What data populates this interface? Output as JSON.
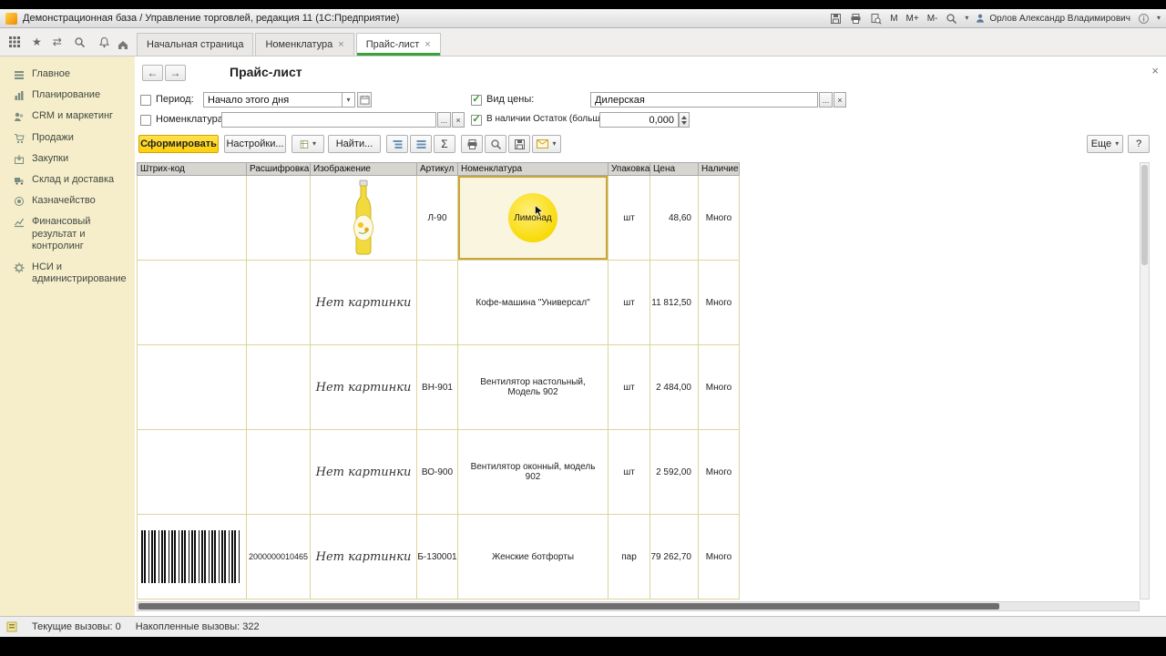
{
  "window": {
    "title": "Демонстрационная база / Управление торговлей, редакция 11 (1С:Предприятие)",
    "memory": [
      "M",
      "M+",
      "M-"
    ],
    "user": "Орлов Александр Владимирович"
  },
  "glyphs": {
    "back": "←",
    "forward": "→",
    "swap": "⇄",
    "star": "★",
    "caret": "▾",
    "close": "×",
    "ellipsis": "...",
    "sum": "Σ",
    "check": "✓"
  },
  "tabs": {
    "items": [
      {
        "label": "Начальная страница"
      },
      {
        "label": "Номенклатура"
      },
      {
        "label": "Прайс-лист"
      }
    ]
  },
  "sidebar": {
    "items": [
      {
        "label": "Главное"
      },
      {
        "label": "Планирование"
      },
      {
        "label": "CRM и маркетинг"
      },
      {
        "label": "Продажи"
      },
      {
        "label": "Закупки"
      },
      {
        "label": "Склад и доставка"
      },
      {
        "label": "Казначейство"
      },
      {
        "label": "Финансовый результат и контролинг"
      },
      {
        "label": "НСИ и администрирование"
      }
    ]
  },
  "page": {
    "title": "Прайс-лист"
  },
  "filters": {
    "period_label": "Период:",
    "period_value": "Начало этого дня",
    "nomenclature_label": "Номенклатура:",
    "nomenclature_value": "",
    "price_type_label": "Вид цены:",
    "price_type_value": "Дилерская",
    "stock_label": "В наличии Остаток (больше):",
    "stock_value": "0,000"
  },
  "toolbar": {
    "generate": "Сформировать",
    "settings": "Настройки...",
    "find": "Найти...",
    "more": "Еще",
    "help": "?"
  },
  "table": {
    "columns": [
      "Штрих-код",
      "Расшифровка",
      "Изображение",
      "Артикул",
      "Номенклатура",
      "Упаковка",
      "Цена",
      "Наличие"
    ],
    "no_image_text": "Нет картинки",
    "rows": [
      {
        "decode": "",
        "article": "Л-90",
        "name": "Лимонад",
        "pack": "шт",
        "price": "48,60",
        "stock": "Много"
      },
      {
        "decode": "",
        "article": "",
        "name": "Кофе-машина \"Универсал\"",
        "pack": "шт",
        "price": "11 812,50",
        "stock": "Много"
      },
      {
        "decode": "",
        "article": "ВН-901",
        "name": "Вентилятор настольный, Модель 902",
        "pack": "шт",
        "price": "2 484,00",
        "stock": "Много"
      },
      {
        "decode": "",
        "article": "ВО-900",
        "name": "Вентилятор оконный, модель 902",
        "pack": "шт",
        "price": "2 592,00",
        "stock": "Много"
      },
      {
        "decode": "2000000010465",
        "article": "Б-130001",
        "name": "Женские ботфорты",
        "pack": "пар",
        "price": "79 262,70",
        "stock": "Много"
      }
    ]
  },
  "statusbar": {
    "current": "Текущие вызовы: 0",
    "accumulated": "Накопленные вызовы: 322"
  }
}
